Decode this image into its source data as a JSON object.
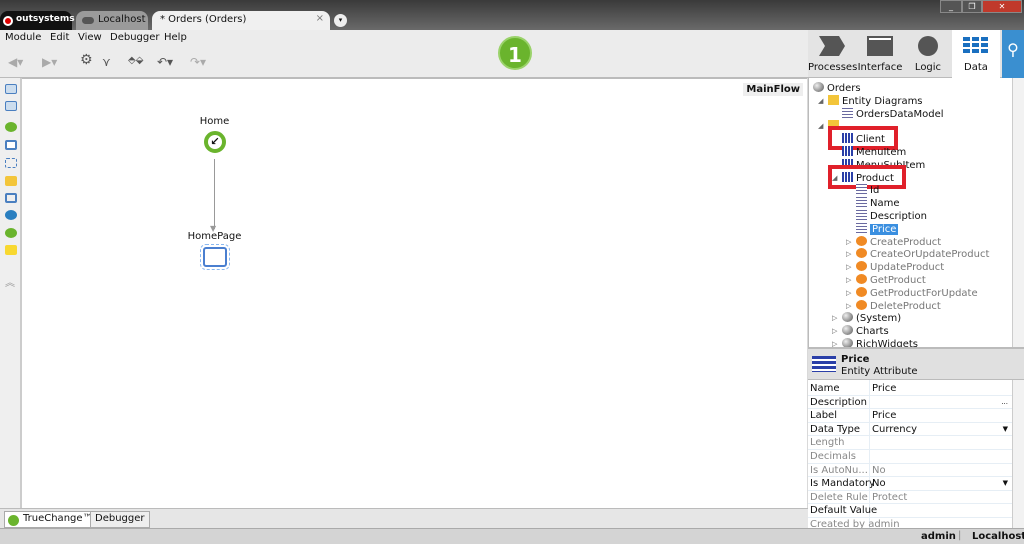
{
  "window": {
    "tabs": [
      {
        "label": "outsystems"
      },
      {
        "label": "Localhost"
      },
      {
        "label": "* Orders (Orders)"
      }
    ],
    "close": "×",
    "more": "▾",
    "controls": [
      "_",
      "❐",
      "✕"
    ]
  },
  "menu": [
    "Module",
    "Edit",
    "View",
    "Debugger",
    "Help"
  ],
  "toolbar": {
    "step_badge": "1",
    "icons": [
      "back-icon",
      "forward-icon",
      "gear-icon",
      "merge-icon",
      "publish-icon",
      "undo-icon",
      "redo-icon"
    ]
  },
  "nav": [
    {
      "label": "Processes"
    },
    {
      "label": "Interface"
    },
    {
      "label": "Logic"
    },
    {
      "label": "Data",
      "active": true
    }
  ],
  "canvas": {
    "flow_name": "MainFlow",
    "nodes": [
      {
        "label": "Home"
      },
      {
        "label": "HomePage"
      }
    ]
  },
  "tree": {
    "items": [
      {
        "label": "Orders",
        "icon": "module"
      },
      {
        "label": "Entity Diagrams",
        "icon": "folder"
      },
      {
        "label": "OrdersDataModel",
        "icon": "diagram"
      },
      {
        "label": "",
        "icon": "folder"
      },
      {
        "label": "Client",
        "icon": "entity",
        "highlight": true
      },
      {
        "label": "MenuItem",
        "icon": "entity"
      },
      {
        "label": "MenuSubItem",
        "icon": "entity"
      },
      {
        "label": "Product",
        "icon": "entity",
        "highlight": true
      },
      {
        "label": "Id",
        "icon": "attribute"
      },
      {
        "label": "Name",
        "icon": "attribute"
      },
      {
        "label": "Description",
        "icon": "attribute"
      },
      {
        "label": "Price",
        "icon": "attribute",
        "selected": true
      },
      {
        "label": "CreateProduct",
        "icon": "action"
      },
      {
        "label": "CreateOrUpdateProduct",
        "icon": "action"
      },
      {
        "label": "UpdateProduct",
        "icon": "action"
      },
      {
        "label": "GetProduct",
        "icon": "action"
      },
      {
        "label": "GetProductForUpdate",
        "icon": "action"
      },
      {
        "label": "DeleteProduct",
        "icon": "action"
      },
      {
        "label": "(System)",
        "icon": "module"
      },
      {
        "label": "Charts",
        "icon": "module"
      },
      {
        "label": "RichWidgets",
        "icon": "module"
      }
    ]
  },
  "properties": {
    "title": "Price",
    "subtitle": "Entity Attribute",
    "rows": [
      {
        "key": "Name",
        "value": "Price"
      },
      {
        "key": "Description",
        "value": "",
        "extra": "..."
      },
      {
        "key": "Label",
        "value": "Price"
      },
      {
        "key": "Data Type",
        "value": "Currency",
        "dropdown": true
      },
      {
        "key": "Length",
        "value": "",
        "disabled": true
      },
      {
        "key": "Decimals",
        "value": "",
        "disabled": true
      },
      {
        "key": "Is AutoNu...",
        "value": "No",
        "disabled": true
      },
      {
        "key": "Is Mandatory",
        "value": "No",
        "dropdown": true
      },
      {
        "key": "Delete Rule",
        "value": "Protect",
        "disabled": true
      },
      {
        "key": "Default Value",
        "value": ""
      },
      {
        "key": "Created by admin",
        "value": "",
        "disabled": true
      }
    ]
  },
  "bottom_tabs": [
    {
      "label": "TrueChange™"
    },
    {
      "label": "Debugger"
    }
  ],
  "status": {
    "user": "admin",
    "server": "Localhost"
  },
  "colors": {
    "accent": "#3a8fd0",
    "highlight_box": "#e0202a",
    "badge": "#6ab42d"
  }
}
